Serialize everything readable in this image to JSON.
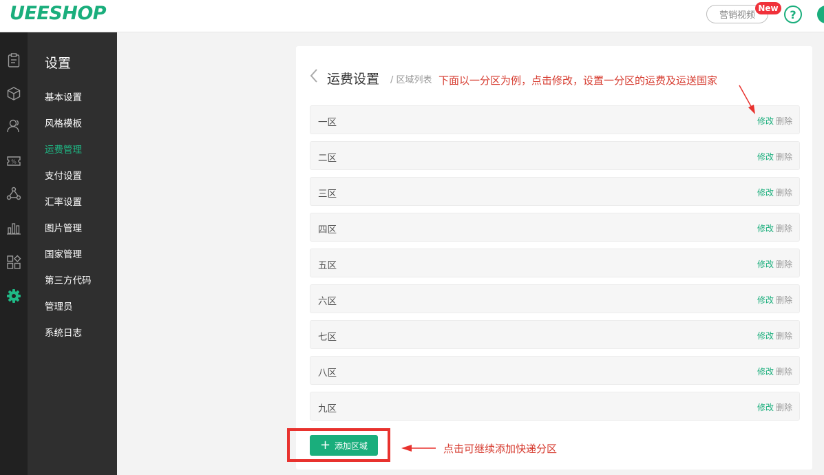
{
  "header": {
    "logo": "UEESHOP",
    "video_label": "营销视频",
    "new_badge": "New",
    "help_label": "?"
  },
  "rail": {
    "icons": [
      "clipboard-icon",
      "box-icon",
      "users-icon",
      "coupon-icon",
      "network-icon",
      "bar-chart-icon",
      "apps-icon",
      "gear-icon"
    ],
    "active": "gear-icon"
  },
  "sidebar": {
    "title": "设置",
    "items": [
      {
        "label": "基本设置"
      },
      {
        "label": "风格模板"
      },
      {
        "label": "运费管理",
        "active": true
      },
      {
        "label": "支付设置"
      },
      {
        "label": "汇率设置"
      },
      {
        "label": "图片管理"
      },
      {
        "label": "国家管理"
      },
      {
        "label": "第三方代码"
      },
      {
        "label": "管理员"
      },
      {
        "label": "系统日志"
      }
    ]
  },
  "main": {
    "title": "运费设置",
    "breadcrumb": "/ 区域列表",
    "edit_label": "修改",
    "delete_label": "删除",
    "zones": [
      {
        "name": "一区"
      },
      {
        "name": "二区"
      },
      {
        "name": "三区"
      },
      {
        "name": "四区"
      },
      {
        "name": "五区"
      },
      {
        "name": "六区"
      },
      {
        "name": "七区"
      },
      {
        "name": "八区"
      },
      {
        "name": "九区"
      }
    ],
    "add_button": "添加区域",
    "add_icon": "+"
  },
  "annotations": {
    "note_top": "下面以一分区为例，点击修改，设置一分区的运费及运送国家",
    "note_bottom": "点击可继续添加快递分区"
  },
  "colors": {
    "accent": "#1aae7c",
    "annotation": "#d63a2e",
    "rail_bg": "#212121",
    "sidebar_bg": "#2f2f2f"
  }
}
